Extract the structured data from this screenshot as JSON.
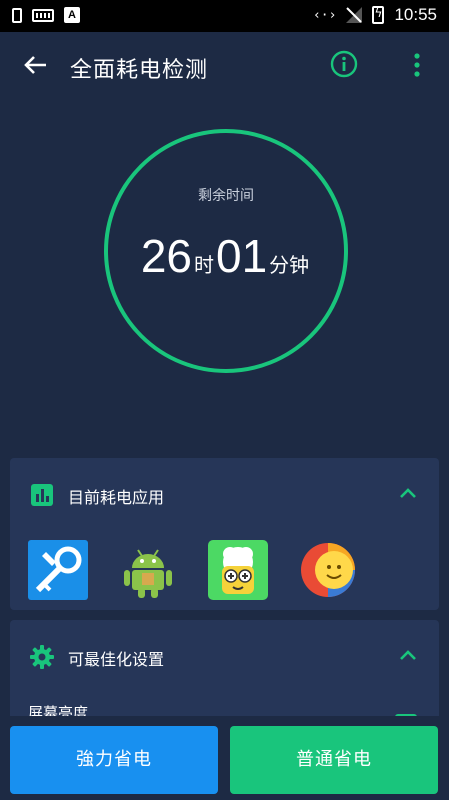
{
  "status_bar": {
    "time": "10:55",
    "data_indicator": "‹·›",
    "notification_letter": "A"
  },
  "toolbar": {
    "title": "全面耗电检测"
  },
  "timer": {
    "label": "剩余时间",
    "hours": "26",
    "hours_unit": "时",
    "minutes": "01",
    "minutes_unit": "分钟"
  },
  "card_apps": {
    "title": "目前耗电应用",
    "apps": [
      {
        "icon": "key-wrench-app-icon"
      },
      {
        "icon": "android-robot-app-icon"
      },
      {
        "icon": "cartoon-face-app-icon"
      },
      {
        "icon": "smiley-colorful-app-icon"
      }
    ]
  },
  "card_optimize": {
    "title": "可最佳化设置",
    "first_item": "屏幕亮度"
  },
  "buttons": {
    "strong_save": "強力省电",
    "normal_save": "普通省电"
  },
  "colors": {
    "background": "#1d2a44",
    "card": "#263658",
    "accent_green": "#19c57c",
    "button_blue": "#1890f0"
  }
}
